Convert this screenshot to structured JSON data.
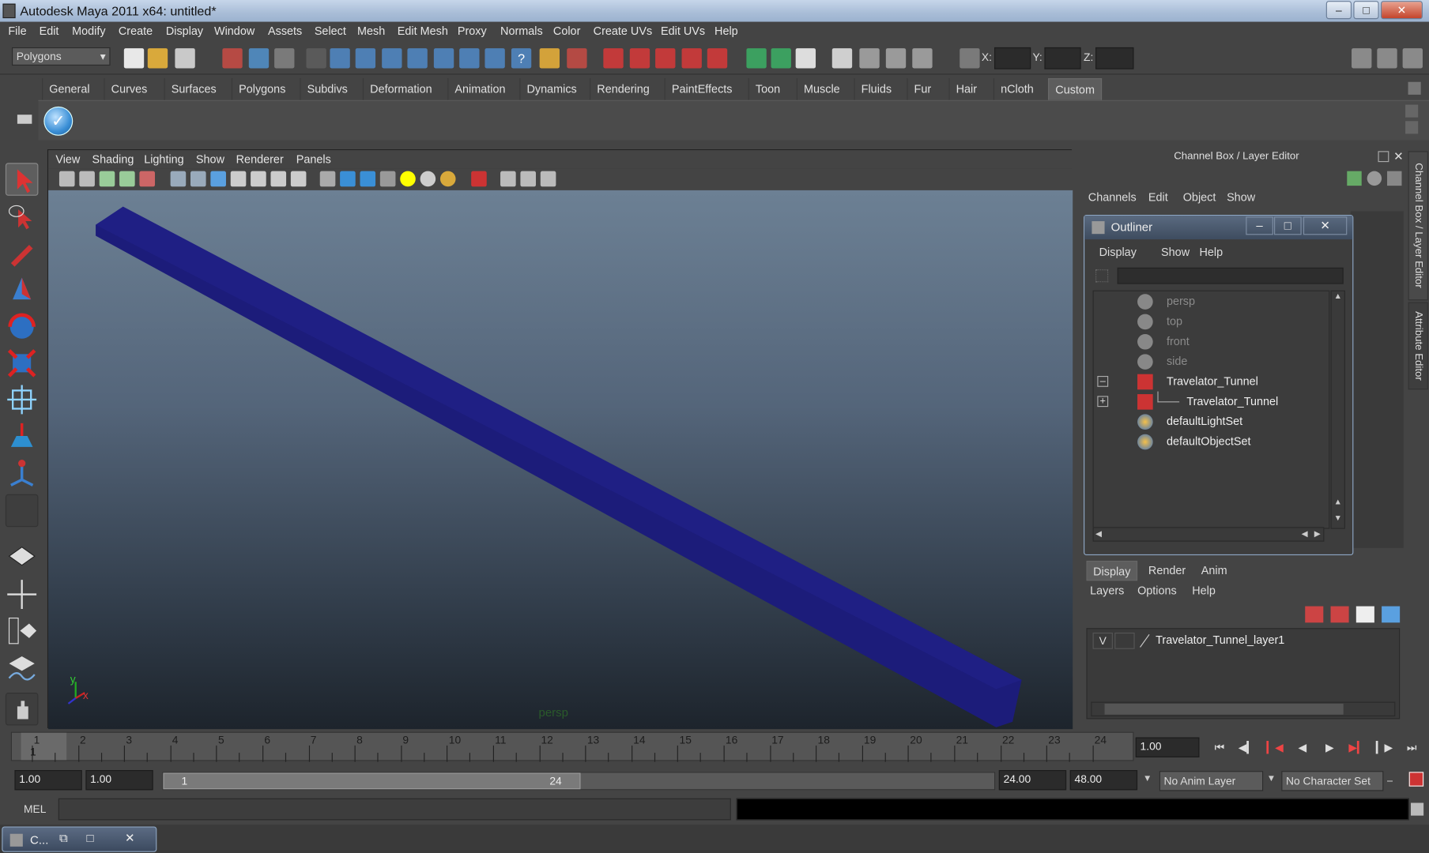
{
  "window": {
    "title": "Autodesk Maya 2011 x64: untitled*"
  },
  "menus": [
    "File",
    "Edit",
    "Modify",
    "Create",
    "Display",
    "Window",
    "Assets",
    "Select",
    "Mesh",
    "Edit Mesh",
    "Proxy",
    "Normals",
    "Color",
    "Create UVs",
    "Edit UVs",
    "Help"
  ],
  "toolbar": {
    "mode": "Polygons",
    "x_label": "X:",
    "y_label": "Y:",
    "z_label": "Z:"
  },
  "shelf_tabs": [
    "General",
    "Curves",
    "Surfaces",
    "Polygons",
    "Subdivs",
    "Deformation",
    "Animation",
    "Dynamics",
    "Rendering",
    "PaintEffects",
    "Toon",
    "Muscle",
    "Fluids",
    "Fur",
    "Hair",
    "nCloth",
    "Custom"
  ],
  "shelf_active": "Custom",
  "viewport": {
    "menus": [
      "View",
      "Shading",
      "Lighting",
      "Show",
      "Renderer",
      "Panels"
    ],
    "camera_label": "persp",
    "axis_x": "x",
    "axis_y": "y"
  },
  "channel_box": {
    "title": "Channel Box / Layer Editor",
    "menus": [
      "Channels",
      "Edit",
      "Object",
      "Show"
    ]
  },
  "side_tabs": {
    "channel": "Channel Box / Layer Editor",
    "attribute": "Attribute Editor"
  },
  "outliner": {
    "title": "Outliner",
    "menus": [
      "Display",
      "Show",
      "Help"
    ],
    "items": [
      {
        "label": "persp",
        "dim": true
      },
      {
        "label": "top",
        "dim": true
      },
      {
        "label": "front",
        "dim": true
      },
      {
        "label": "side",
        "dim": true
      },
      {
        "label": "Travelator_Tunnel",
        "dim": false
      },
      {
        "label": "Travelator_Tunnel",
        "dim": false
      },
      {
        "label": "defaultLightSet",
        "dim": false
      },
      {
        "label": "defaultObjectSet",
        "dim": false
      }
    ]
  },
  "layer_editor": {
    "tabs": [
      "Display",
      "Render",
      "Anim"
    ],
    "menus": [
      "Layers",
      "Options",
      "Help"
    ],
    "layer_v": "V",
    "layer_name": "Travelator_Tunnel_layer1"
  },
  "timeline": {
    "ticks": [
      "1",
      "2",
      "3",
      "4",
      "5",
      "6",
      "7",
      "8",
      "9",
      "10",
      "11",
      "12",
      "13",
      "14",
      "15",
      "16",
      "17",
      "18",
      "19",
      "20",
      "21",
      "22",
      "23",
      "24"
    ],
    "current_frame": "1",
    "current_time": "1.00"
  },
  "range": {
    "start": "1.00",
    "anim_start": "1.00",
    "slider_start": "1",
    "slider_end": "24",
    "anim_end": "24.00",
    "end": "48.00",
    "anim_layer": "No Anim Layer",
    "character_set": "No Character Set"
  },
  "command": {
    "label": "MEL"
  },
  "taskbar": {
    "item": "C..."
  },
  "colors": {
    "tunnel": "#1c1c7a",
    "accent": "#3a8fd6"
  }
}
